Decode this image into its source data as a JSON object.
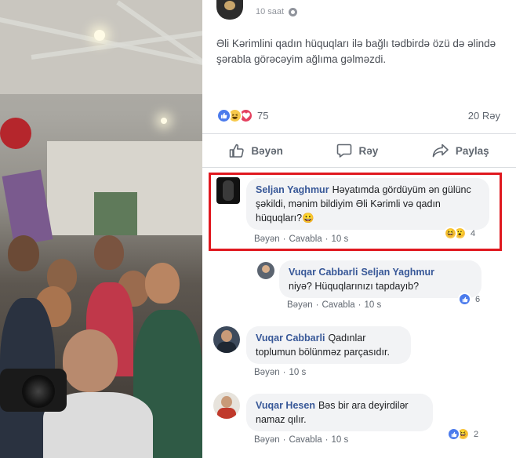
{
  "post": {
    "time": "10 saat",
    "text": "Əli Kərimlini qadın hüquqları ilə bağlı tədbirdə özü də əlində şərabla görəcəyim ağlıma gəlməzdi.",
    "reaction_count": "75",
    "comment_count": "20 Rəy",
    "reaction_icons": [
      "like-icon",
      "haha-icon",
      "love-icon"
    ]
  },
  "actions": {
    "like": "Bəyən",
    "comment": "Rəy",
    "share": "Paylaş"
  },
  "comments": [
    {
      "author": "Seljan Yaghmur",
      "text": "Həyatımda gördüyüm ən gülünc şəkildi, mənim bildiyim Əli Kərimli və qadın hüquqları?😀",
      "like": "Bəyən",
      "reply": "Cavabla",
      "time": "10 s",
      "reactions": "4"
    },
    {
      "author": "Vuqar Cabbarli",
      "mention": "Seljan Yaghmur",
      "text": "niyə? Hüquqlarınızı tapdayıb?",
      "like": "Bəyən",
      "reply": "Cavabla",
      "time": "10 s",
      "reactions": "6"
    },
    {
      "author": "Vuqar Cabbarli",
      "text": "Qadınlar toplumun bölünməz parçasıdır.",
      "like": "Bəyən",
      "time": "10 s"
    },
    {
      "author": "Vuqar Hesen",
      "text": "Bəs bir ara deyirdilər namaz qılır.",
      "like": "Bəyən",
      "reply": "Cavabla",
      "time": "10 s",
      "reactions": "2"
    }
  ],
  "colors": {
    "highlight": "#e0181f",
    "link": "#385898",
    "bubble": "#f2f3f5"
  }
}
